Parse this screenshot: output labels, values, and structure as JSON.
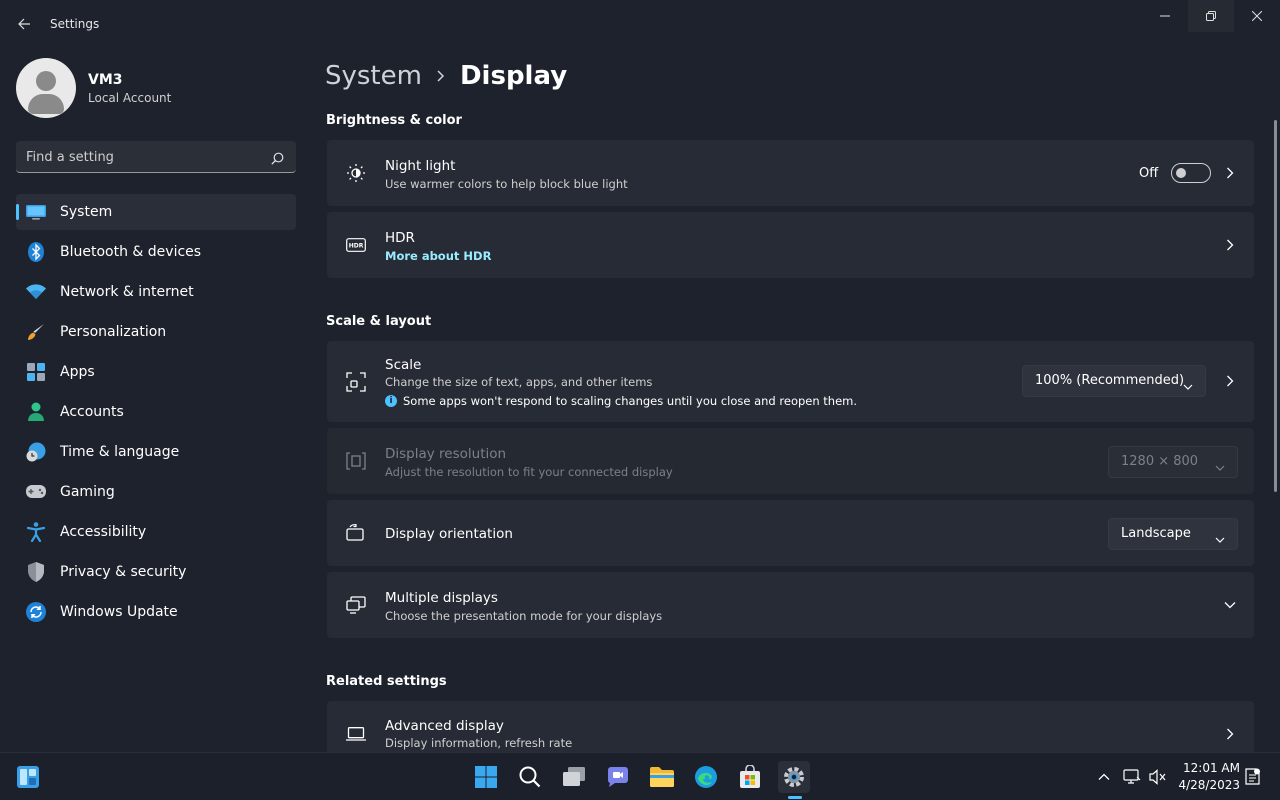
{
  "window": {
    "title": "Settings"
  },
  "profile": {
    "name": "VM3",
    "account_type": "Local Account"
  },
  "search": {
    "placeholder": "Find a setting"
  },
  "sidebar": {
    "items": [
      {
        "label": "System",
        "icon": "monitor-icon",
        "active": true
      },
      {
        "label": "Bluetooth & devices",
        "icon": "bluetooth-icon"
      },
      {
        "label": "Network & internet",
        "icon": "wifi-icon"
      },
      {
        "label": "Personalization",
        "icon": "brush-icon"
      },
      {
        "label": "Apps",
        "icon": "apps-icon"
      },
      {
        "label": "Accounts",
        "icon": "person-icon"
      },
      {
        "label": "Time & language",
        "icon": "globe-clock-icon"
      },
      {
        "label": "Gaming",
        "icon": "gamepad-icon"
      },
      {
        "label": "Accessibility",
        "icon": "accessibility-icon"
      },
      {
        "label": "Privacy & security",
        "icon": "shield-icon"
      },
      {
        "label": "Windows Update",
        "icon": "update-icon"
      }
    ]
  },
  "breadcrumb": {
    "parent": "System",
    "current": "Display"
  },
  "sections": {
    "brightness": "Brightness & color",
    "scale_layout": "Scale & layout",
    "related": "Related settings"
  },
  "night_light": {
    "title": "Night light",
    "subtitle": "Use warmer colors to help block blue light",
    "toggle_label": "Off",
    "enabled": false
  },
  "hdr": {
    "title": "HDR",
    "link": "More about HDR"
  },
  "scale": {
    "title": "Scale",
    "subtitle": "Change the size of text, apps, and other items",
    "info": "Some apps won't respond to scaling changes until you close and reopen them.",
    "value": "100% (Recommended)"
  },
  "resolution": {
    "title": "Display resolution",
    "subtitle": "Adjust the resolution to fit your connected display",
    "value": "1280 × 800",
    "disabled": true
  },
  "orientation": {
    "title": "Display orientation",
    "value": "Landscape"
  },
  "multiple_displays": {
    "title": "Multiple displays",
    "subtitle": "Choose the presentation mode for your displays"
  },
  "advanced_display": {
    "title": "Advanced display",
    "subtitle": "Display information, refresh rate"
  },
  "taskbar": {
    "time": "12:01 AM",
    "date": "4/28/2023"
  },
  "colors": {
    "accent": "#4cc2ff",
    "link": "#99ebff",
    "background": "#1e222c",
    "card": "#272b35"
  }
}
